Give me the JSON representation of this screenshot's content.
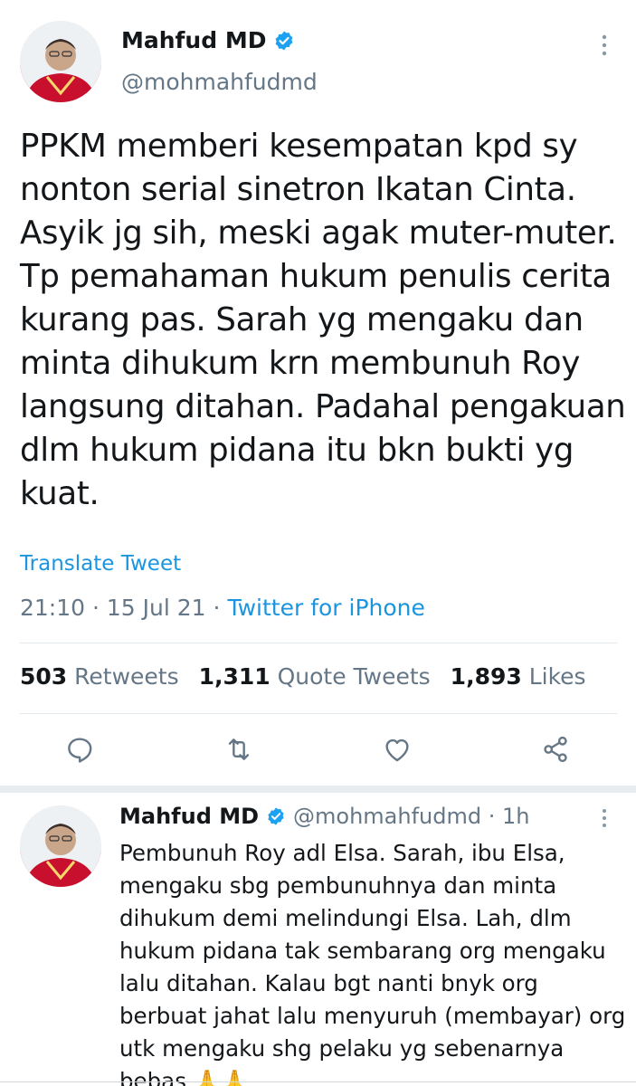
{
  "main_tweet": {
    "author_name": "Mahfud MD",
    "author_handle": "@mohmahfudmd",
    "text": "PPKM memberi kesempatan kpd sy\nnonton serial sinetron Ikatan Cinta.\nAsyik jg sih, meski agak muter-muter.\nTp pemahaman hukum penulis cerita\nkurang pas. Sarah yg mengaku dan\nminta dihukum krn membunuh Roy\nlangsung ditahan. Padahal pengakuan\ndlm hukum pidana itu bkn bukti yg\nkuat.",
    "translate_label": "Translate Tweet",
    "time": "21:10",
    "date": "15 Jul 21",
    "source": "Twitter for iPhone",
    "stats": {
      "retweets_count": "503",
      "retweets_label": "Retweets",
      "quotes_count": "1,311",
      "quotes_label": "Quote Tweets",
      "likes_count": "1,893",
      "likes_label": "Likes"
    },
    "icons": [
      "reply-icon",
      "retweet-icon",
      "like-icon",
      "share-icon"
    ]
  },
  "reply_tweet": {
    "author_name": "Mahfud MD",
    "author_handle": "@mohmahfudmd",
    "age": "1h",
    "text": "Pembunuh Roy adl Elsa. Sarah, ibu Elsa,\nmengaku sbg pembunuhnya dan minta\ndihukum demi melindungi Elsa. Lah, dlm\nhukum pidana tak sembarang org mengaku\nlalu ditahan. Kalau bgt nanti bnyk org\nberbuat jahat lalu menyuruh (membayar) org\nutk mengaku shg pelaku yg sebenarnya\nbebas 🙏🙏"
  },
  "colors": {
    "accent": "#1b95e0",
    "verified": "#1da1f2",
    "secondary_text": "#657786",
    "divider": "#e1e8ed"
  }
}
